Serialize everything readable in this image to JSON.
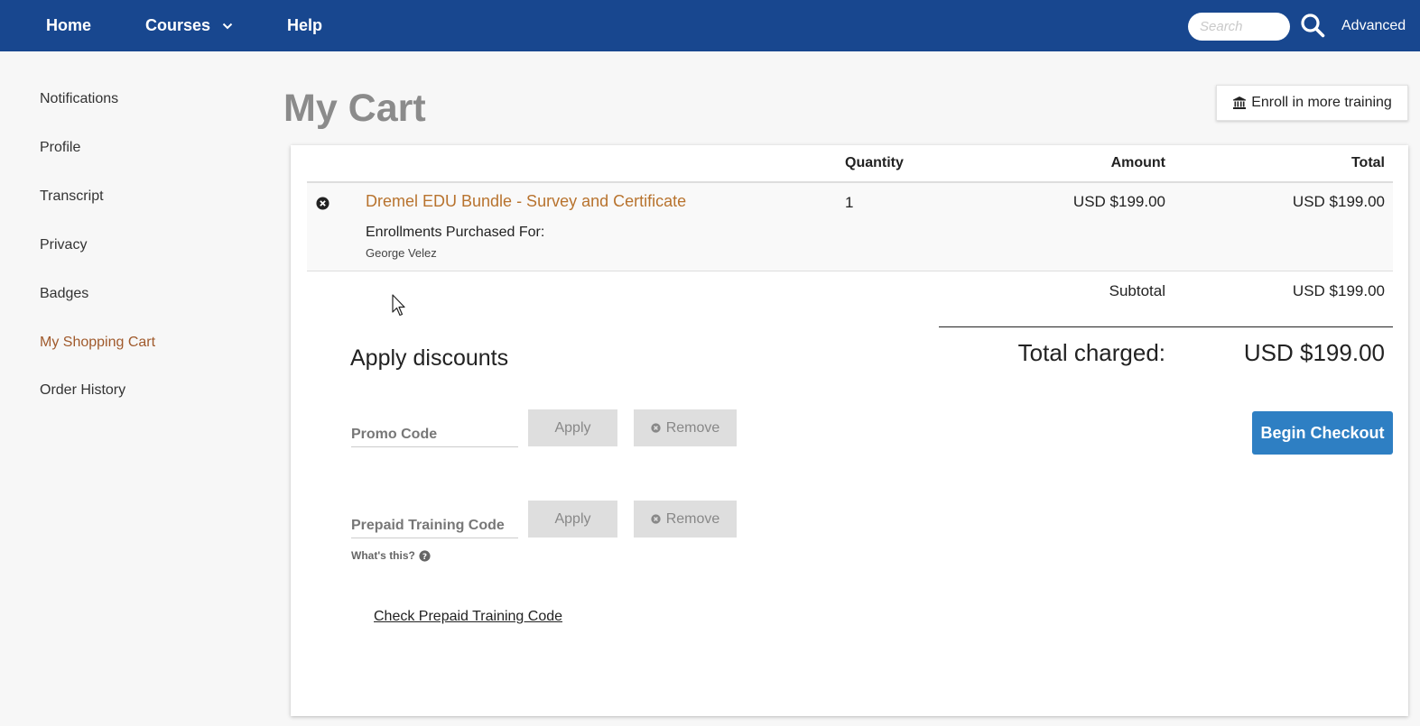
{
  "nav": {
    "home": "Home",
    "courses": "Courses",
    "help": "Help",
    "search_placeholder": "Search",
    "advanced": "Advanced",
    "bar_color": "#18478f"
  },
  "sidebar": {
    "items": [
      {
        "label": "Notifications"
      },
      {
        "label": "Profile"
      },
      {
        "label": "Transcript"
      },
      {
        "label": "Privacy"
      },
      {
        "label": "Badges"
      },
      {
        "label": "My Shopping Cart",
        "active": true
      },
      {
        "label": "Order History"
      }
    ]
  },
  "page": {
    "title": "My Cart",
    "enroll_more": "Enroll in more training"
  },
  "cart": {
    "columns": {
      "quantity": "Quantity",
      "amount": "Amount",
      "total": "Total"
    },
    "items": [
      {
        "name": "Dremel EDU Bundle - Survey and Certificate",
        "purchased_for_label": "Enrollments Purchased For:",
        "purchased_for": "George Velez",
        "quantity": "1",
        "amount": "USD $199.00",
        "total": "USD $199.00"
      }
    ],
    "subtotal_label": "Subtotal",
    "subtotal": "USD $199.00",
    "total_label": "Total charged:",
    "total": "USD $199.00",
    "checkout": "Begin Checkout"
  },
  "discounts": {
    "title": "Apply discounts",
    "promo_placeholder": "Promo Code",
    "prepaid_placeholder": "Prepaid Training Code",
    "apply": "Apply",
    "remove": "Remove",
    "whats_this": "What's this?",
    "check_prepaid": "Check Prepaid Training Code"
  },
  "colors": {
    "link": "#b8732e",
    "active_sidebar": "#a05a2c",
    "checkout": "#2e7fc3"
  }
}
